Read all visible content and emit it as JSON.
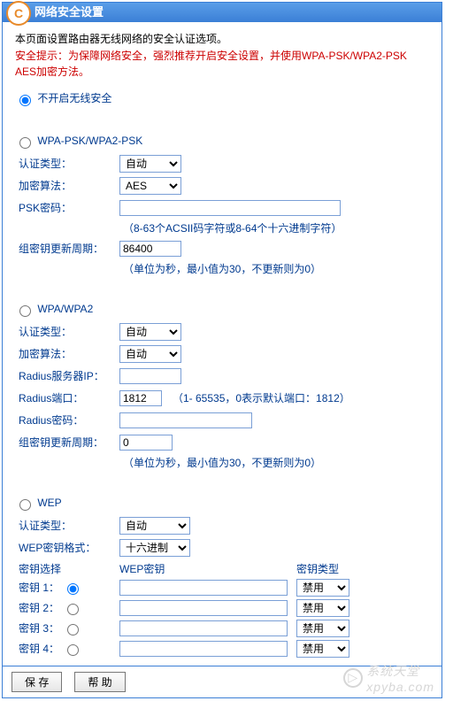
{
  "header": {
    "title": "网络安全设置"
  },
  "intro": "本页面设置路由器无线网络的安全认证选项。",
  "warning": "安全提示：为保障网络安全，强烈推荐开启安全设置，并使用WPA-PSK/WPA2-PSK AES加密方法。",
  "modes": {
    "disable": {
      "label": "不开启无线安全",
      "checked": true
    },
    "wpapsk": {
      "label": "WPA-PSK/WPA2-PSK",
      "checked": false
    },
    "wpa": {
      "label": "WPA/WPA2",
      "checked": false
    },
    "wep": {
      "label": "WEP",
      "checked": false
    }
  },
  "wpapsk": {
    "auth_label": "认证类型：",
    "auth_value": "自动",
    "enc_label": "加密算法：",
    "enc_value": "AES",
    "psk_label": "PSK密码：",
    "psk_value": "",
    "psk_hint": "（8-63个ACSII码字符或8-64个十六进制字符）",
    "gk_label": "组密钥更新周期：",
    "gk_value": "86400",
    "gk_hint": "（单位为秒，最小值为30，不更新则为0）"
  },
  "wpa": {
    "auth_label": "认证类型：",
    "auth_value": "自动",
    "enc_label": "加密算法：",
    "enc_value": "自动",
    "radius_ip_label": "Radius服务器IP：",
    "radius_ip_value": "",
    "radius_port_label": "Radius端口：",
    "radius_port_value": "1812",
    "radius_port_hint": "（1- 65535，0表示默认端口：1812）",
    "radius_pw_label": "Radius密码：",
    "radius_pw_value": "",
    "gk_label": "组密钥更新周期：",
    "gk_value": "0",
    "gk_hint": "（单位为秒，最小值为30，不更新则为0）"
  },
  "wep": {
    "auth_label": "认证类型：",
    "auth_value": "自动",
    "fmt_label": "WEP密钥格式：",
    "fmt_value": "十六进制",
    "col_select": "密钥选择",
    "col_key": "WEP密钥",
    "col_type": "密钥类型",
    "keys": [
      {
        "label": "密钥 1：",
        "value": "",
        "type": "禁用",
        "selected": true
      },
      {
        "label": "密钥 2：",
        "value": "",
        "type": "禁用",
        "selected": false
      },
      {
        "label": "密钥 3：",
        "value": "",
        "type": "禁用",
        "selected": false
      },
      {
        "label": "密钥 4：",
        "value": "",
        "type": "禁用",
        "selected": false
      }
    ]
  },
  "buttons": {
    "save": "保 存",
    "help": "帮 助"
  },
  "watermark": {
    "line1": "系统天堂",
    "line2": "xpyba.com"
  }
}
